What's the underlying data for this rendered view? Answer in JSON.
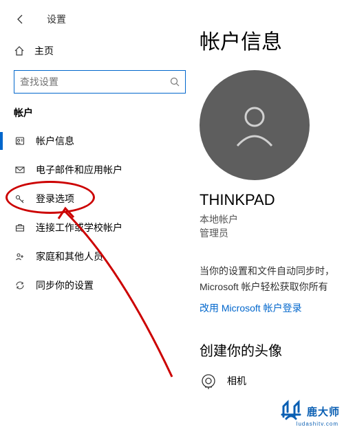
{
  "header": {
    "title": "设置"
  },
  "sidebar": {
    "home_label": "主页",
    "search_placeholder": "查找设置",
    "section_title": "帐户",
    "items": [
      {
        "label": "帐户信息",
        "icon": "user-icon",
        "active": true
      },
      {
        "label": "电子邮件和应用帐户",
        "icon": "mail-icon",
        "active": false
      },
      {
        "label": "登录选项",
        "icon": "key-icon",
        "active": false
      },
      {
        "label": "连接工作或学校帐户",
        "icon": "briefcase-icon",
        "active": false
      },
      {
        "label": "家庭和其他人员",
        "icon": "people-icon",
        "active": false
      },
      {
        "label": "同步你的设置",
        "icon": "sync-icon",
        "active": false
      }
    ]
  },
  "main": {
    "page_title": "帐户信息",
    "username": "THINKPAD",
    "account_type_line1": "本地帐户",
    "account_type_line2": "管理员",
    "sync_description_line1": "当你的设置和文件自动同步时，",
    "sync_description_line2": "Microsoft 帐户轻松获取你所有",
    "ms_login_link": "改用 Microsoft 帐户登录",
    "avatar_section_title": "创建你的头像",
    "camera_label": "相机"
  },
  "watermark": {
    "text": "鹿大师",
    "url": "ludashitv.com"
  }
}
